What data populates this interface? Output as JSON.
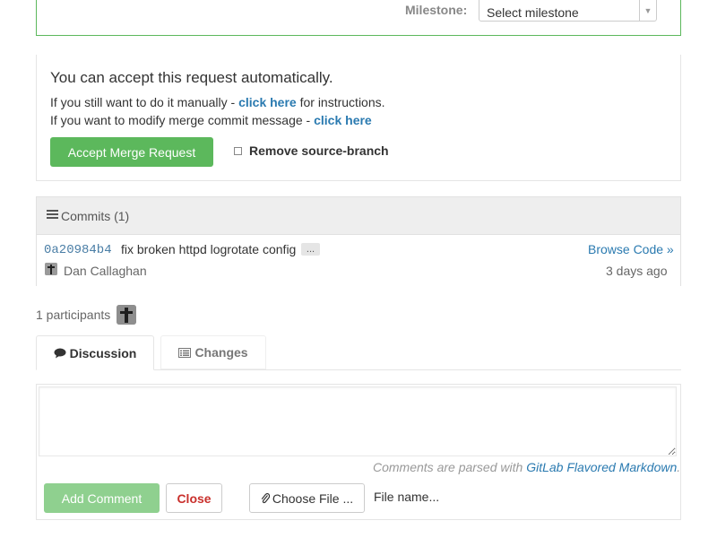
{
  "milestone": {
    "label": "Milestone:",
    "select_value": "Select milestone"
  },
  "accept": {
    "title": "You can accept this request automatically.",
    "line1_prefix": "If you still want to do it manually - ",
    "line1_link": "click here",
    "line1_suffix": " for instructions.",
    "line2_prefix": "If you want to modify merge commit message - ",
    "line2_link": "click here",
    "accept_button": "Accept Merge Request",
    "remove_branch_label": "Remove source-branch",
    "remove_branch_checked": false
  },
  "commits": {
    "header": "Commits (1)",
    "items": [
      {
        "sha": "0a20984b4",
        "message": "fix broken httpd logrotate config",
        "more": "...",
        "browse_link": "Browse Code »",
        "author": "Dan Callaghan",
        "time": "3 days ago"
      }
    ]
  },
  "participants": {
    "label": "1 participants"
  },
  "tabs": [
    {
      "label": "Discussion",
      "icon": "comment-icon",
      "active": true
    },
    {
      "label": "Changes",
      "icon": "list-alt-icon",
      "active": false
    }
  ],
  "comment": {
    "textarea_value": "",
    "markdown_prefix": "Comments are parsed with ",
    "markdown_link": "GitLab Flavored Markdown",
    "markdown_suffix": ".",
    "add_button": "Add Comment",
    "close_button": "Close",
    "choose_file_button": "Choose File ...",
    "file_name": "File name..."
  },
  "colors": {
    "accent_green": "#5cb85c",
    "link_blue": "#2a7ab0",
    "danger_red": "#c9302c"
  }
}
